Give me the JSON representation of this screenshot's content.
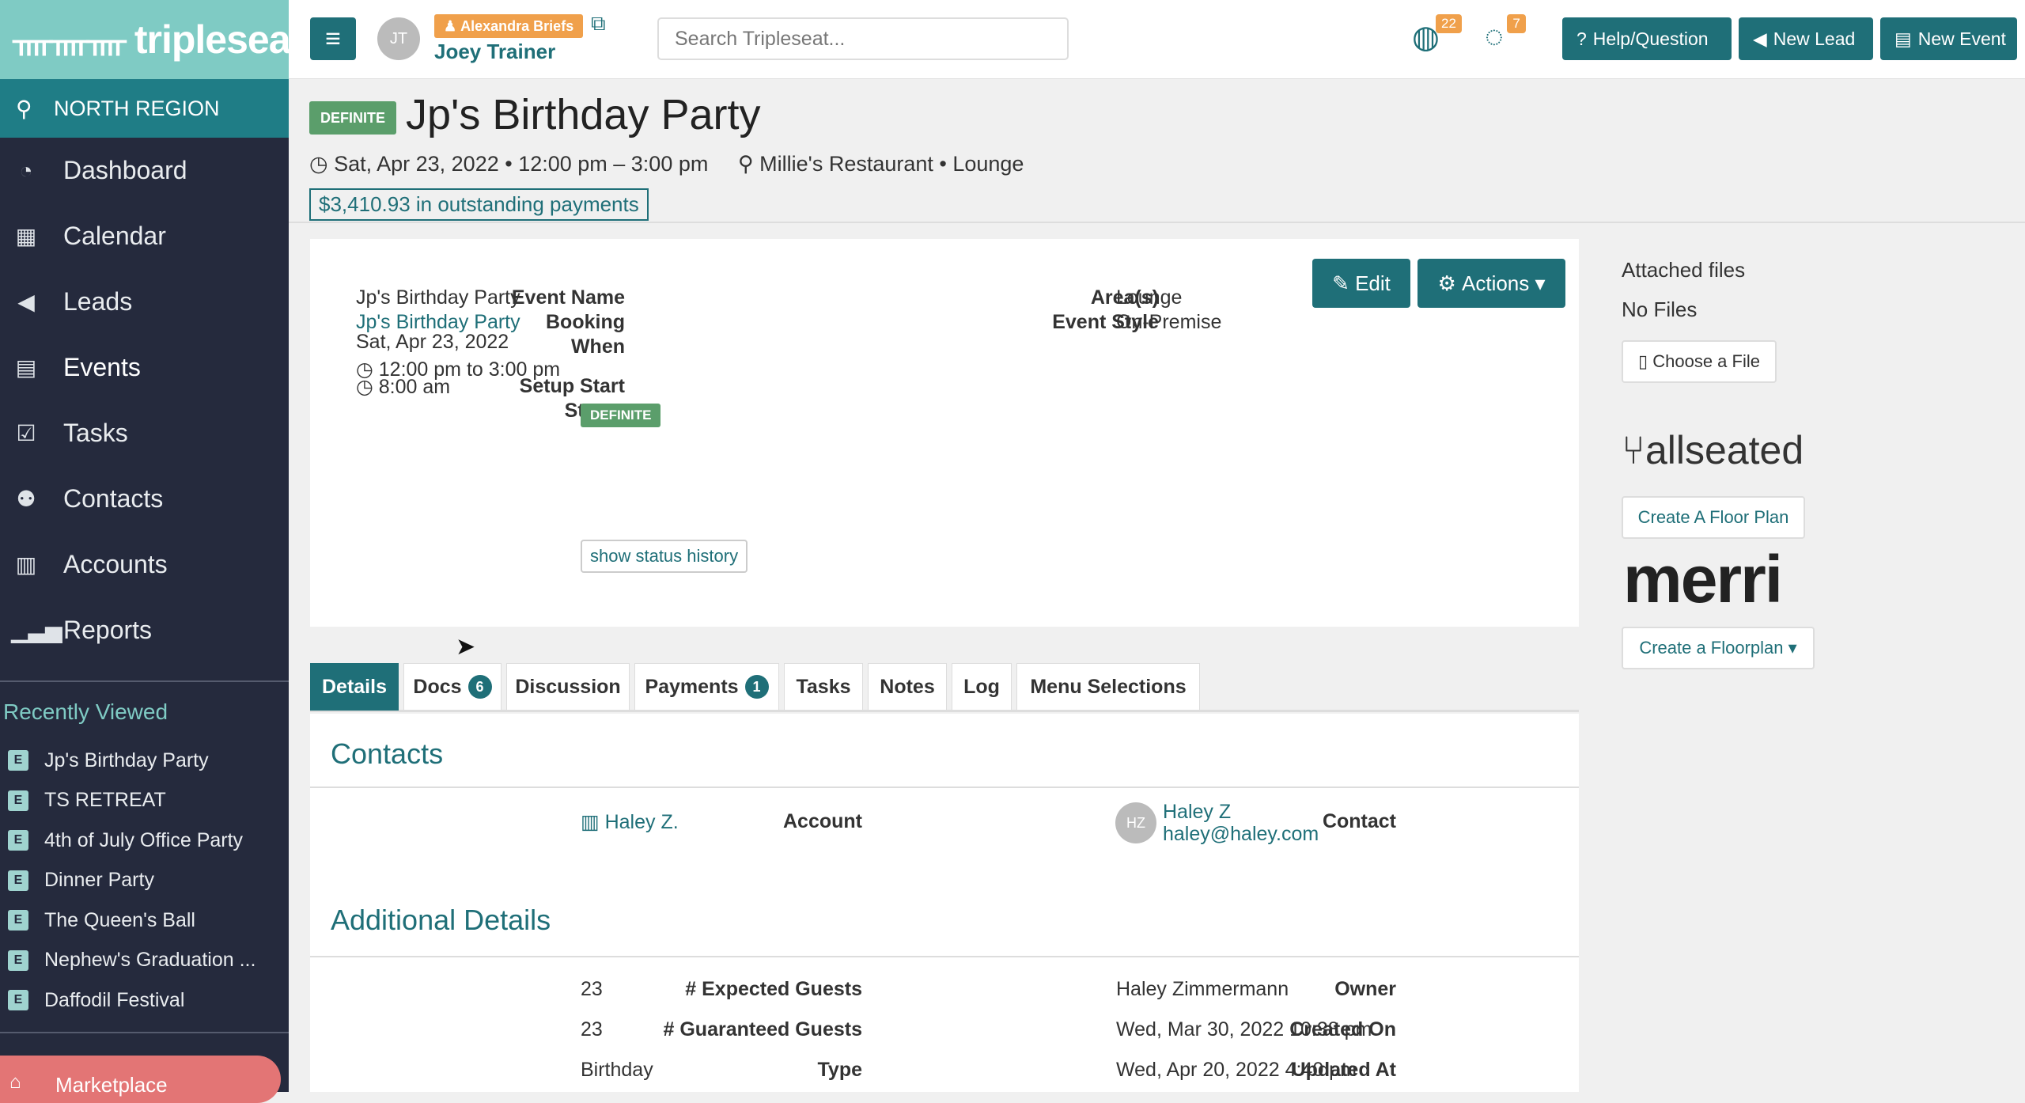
{
  "app": {
    "logo_text": "tripleseat"
  },
  "sidebar": {
    "region": "NORTH REGION",
    "items": [
      {
        "label": "Dashboard",
        "icon": "dashboard-icon"
      },
      {
        "label": "Calendar",
        "icon": "calendar-icon"
      },
      {
        "label": "Leads",
        "icon": "megaphone-icon"
      },
      {
        "label": "Events",
        "icon": "events-icon"
      },
      {
        "label": "Tasks",
        "icon": "checkbox-icon"
      },
      {
        "label": "Contacts",
        "icon": "users-icon"
      },
      {
        "label": "Accounts",
        "icon": "building-icon"
      },
      {
        "label": "Reports",
        "icon": "chart-icon"
      }
    ],
    "recent_title": "Recently Viewed",
    "recent_badge": "E",
    "recent": [
      "Jp's Birthday Party",
      "TS RETREAT",
      "4th of July Office Party",
      "Dinner Party",
      "The Queen's Ball",
      "Nephew's Graduation ...",
      "Daffodil Festival"
    ],
    "marketplace": "Marketplace"
  },
  "topbar": {
    "avatar_initials": "JT",
    "impersonating": "Alexandra Briefs",
    "user_name": "Joey Trainer",
    "search_placeholder": "Search Tripleseat...",
    "notif_globe_count": "22",
    "notif_chat_count": "7",
    "help_label": "Help/Question",
    "new_lead_label": "New Lead",
    "new_event_label": "New Event"
  },
  "event": {
    "status": "DEFINITE",
    "title": "Jp's Birthday Party",
    "when_line": "Sat, Apr 23, 2022 • 12:00 pm – 3:00 pm",
    "location_line": "Millie's Restaurant • Lounge",
    "outstanding": "$3,410.93 in outstanding payments",
    "edit_label": "Edit",
    "actions_label": "Actions",
    "fields": {
      "event_name_label": "Event Name",
      "event_name": "Jp's Birthday Party",
      "booking_label": "Booking",
      "booking": "Jp's Birthday Party",
      "when_label": "When",
      "when_date": "Sat, Apr 23, 2022",
      "when_time": "12:00 pm to 3:00 pm",
      "setup_label": "Setup Start",
      "setup": "8:00 am",
      "status_label": "Status",
      "status": "DEFINITE",
      "history_label": "show status history",
      "areas_label": "Area(s)",
      "areas": "Lounge",
      "style_label": "Event Style",
      "style": "On-Premise"
    }
  },
  "tabs": [
    {
      "label": "Details",
      "count": ""
    },
    {
      "label": "Docs",
      "count": "6"
    },
    {
      "label": "Discussion",
      "count": ""
    },
    {
      "label": "Payments",
      "count": "1"
    },
    {
      "label": "Tasks",
      "count": ""
    },
    {
      "label": "Notes",
      "count": ""
    },
    {
      "label": "Log",
      "count": ""
    },
    {
      "label": "Menu Selections",
      "count": ""
    }
  ],
  "details": {
    "contacts_title": "Contacts",
    "account_label": "Account",
    "account": "Haley Z.",
    "contact_label": "Contact",
    "contact_initials": "HZ",
    "contact_name": "Haley Z",
    "contact_email": "haley@haley.com",
    "additional_title": "Additional Details",
    "expected_label": "# Expected Guests",
    "expected": "23",
    "guaranteed_label": "# Guaranteed Guests",
    "guaranteed": "23",
    "type_label": "Type",
    "type": "Birthday",
    "owner_label": "Owner",
    "owner": "Haley Zimmermann",
    "created_label": "Created On",
    "created": "Wed, Mar 30, 2022 10:38 pm",
    "updated_label": "Updated At",
    "updated": "Wed, Apr 20, 2022 4:40 pm"
  },
  "right": {
    "files_title": "Attached files",
    "no_files": "No Files",
    "choose_file": "Choose a File",
    "allseated_logo": "allseated",
    "floor_plan_label": "Create A Floor Plan",
    "merri_logo": "merri",
    "floorplan2_label": "Create a Floorplan"
  },
  "colors": {
    "brand": "#1f6f78",
    "sidebar": "#252a3d",
    "accent": "#7fcbc4",
    "definite": "#5b9e6b",
    "badge": "#f0a04b"
  }
}
